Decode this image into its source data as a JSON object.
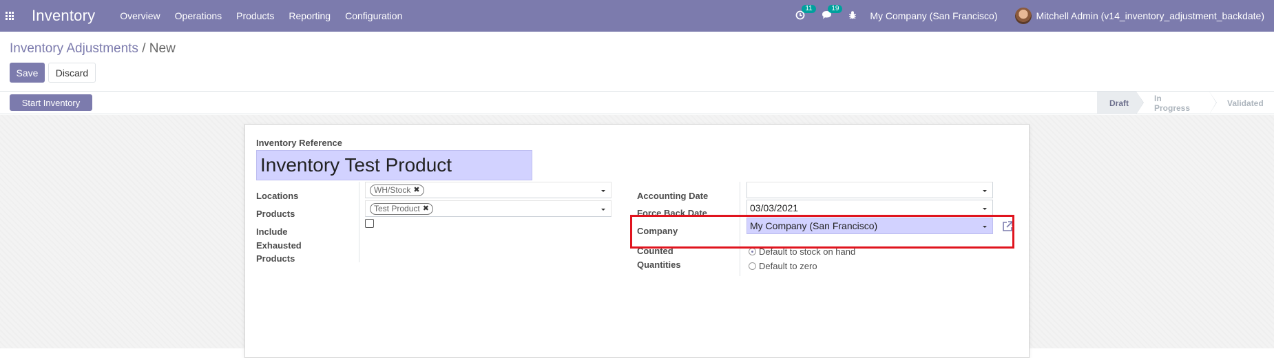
{
  "navbar": {
    "app_name": "Inventory",
    "menu": [
      "Overview",
      "Operations",
      "Products",
      "Reporting",
      "Configuration"
    ],
    "activity_count": "11",
    "message_count": "19",
    "company": "My Company (San Francisco)",
    "user": "Mitchell Admin (v14_inventory_adjustment_backdate)",
    "brand_color": "#7c7bad"
  },
  "breadcrumb": {
    "parent": "Inventory Adjustments",
    "separator": "/",
    "current": "New"
  },
  "buttons": {
    "save": "Save",
    "discard": "Discard",
    "start_inventory": "Start Inventory"
  },
  "statusbar": {
    "stages": [
      "Draft",
      "In Progress",
      "Validated"
    ],
    "active": "Draft"
  },
  "form": {
    "reference_label": "Inventory Reference",
    "reference_value": "Inventory Test Product",
    "locations_label": "Locations",
    "locations_tags": [
      "WH/Stock"
    ],
    "products_label": "Products",
    "products_tags": [
      "Test Product"
    ],
    "include_exhausted_label_1": "Include",
    "include_exhausted_label_2": "Exhausted",
    "include_exhausted_label_3": "Products",
    "include_exhausted_checked": false,
    "accounting_date_label": "Accounting Date",
    "accounting_date_value": "",
    "force_back_date_label": "Force Back Date",
    "force_back_date_value": "03/03/2021",
    "company_label": "Company",
    "company_value": "My Company (San Francisco)",
    "counted_quantities_label_1": "Counted",
    "counted_quantities_label_2": "Quantities",
    "counted_options": [
      "Default to stock on hand",
      "Default to zero"
    ],
    "counted_selected": "Default to stock on hand"
  },
  "highlight_color": "#e0141e"
}
